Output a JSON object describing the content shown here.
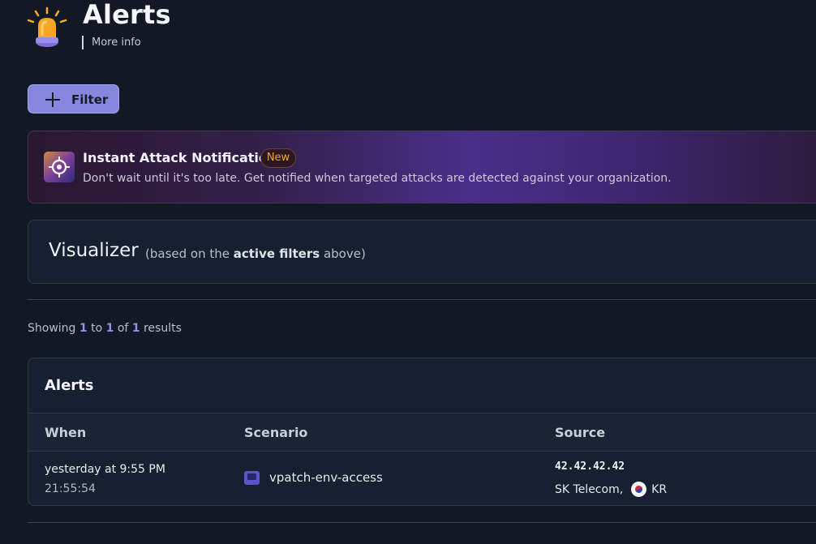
{
  "header": {
    "icon": "siren-icon",
    "title": "Alerts",
    "more_info": "More info"
  },
  "toolbar": {
    "filter_label": "Filter",
    "filter_icon": "plus-icon"
  },
  "banner": {
    "icon": "target-icon",
    "title": "Instant Attack Notification",
    "badge": "New",
    "description": "Don't wait until it's too late. Get notified when targeted attacks are detected against your organization."
  },
  "visualizer": {
    "title": "Visualizer",
    "sub_prefix": "(based on the",
    "sub_bold": "active filters",
    "sub_suffix": "above)"
  },
  "results": {
    "showing_word": "Showing",
    "from": "1",
    "to_word": "to",
    "to": "1",
    "of_word": "of",
    "total": "1",
    "results_word": "results"
  },
  "table": {
    "title": "Alerts",
    "columns": [
      "When",
      "Scenario",
      "Source"
    ],
    "rows": [
      {
        "when_relative": "yesterday at 9:55 PM",
        "when_time": "21:55:54",
        "scenario_icon": "scenario-icon",
        "scenario": "vpatch-env-access",
        "source_ip": "42.42.42.42",
        "source_isp": "SK Telecom,",
        "source_flag": "kr-flag-icon",
        "source_country": "KR"
      }
    ]
  },
  "colors": {
    "background": "#131924",
    "card": "#172030",
    "accent": "#8686df",
    "badge_text": "#f0a33a"
  }
}
